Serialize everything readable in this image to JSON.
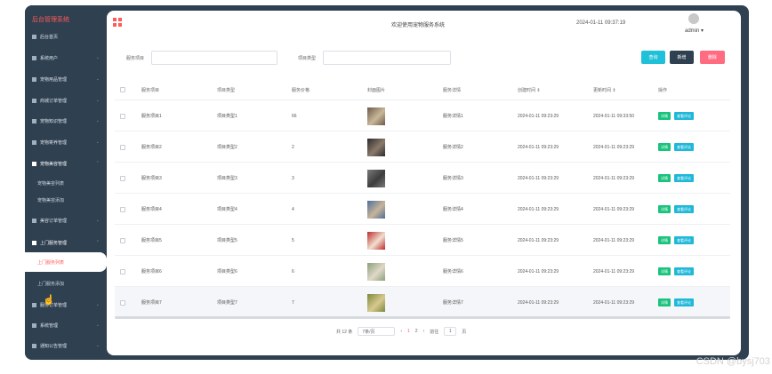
{
  "sidebar": {
    "brand": "后台管理系统",
    "items": [
      {
        "label": "后台首页",
        "arrow": ""
      },
      {
        "label": "系统用户",
        "arrow": "⌄"
      },
      {
        "label": "宠物用品管理",
        "arrow": "⌄"
      },
      {
        "label": "商城订单管理",
        "arrow": "⌄"
      },
      {
        "label": "宠物知识管理",
        "arrow": "⌄"
      },
      {
        "label": "宠物寄养管理",
        "arrow": "⌄"
      },
      {
        "label": "宠物美容管理",
        "arrow": "⌃"
      },
      {
        "label": "宠物美容列表",
        "arrow": ""
      },
      {
        "label": "宠物美容添加",
        "arrow": ""
      },
      {
        "label": "美容订单管理",
        "arrow": "⌄"
      },
      {
        "label": "上门服务管理",
        "arrow": "⌃"
      },
      {
        "label": "上门服务列表",
        "arrow": ""
      },
      {
        "label": "上门服务添加",
        "arrow": ""
      },
      {
        "label": "服务订单管理",
        "arrow": "⌄"
      },
      {
        "label": "系统管理",
        "arrow": "⌄"
      },
      {
        "label": "通知公告管理",
        "arrow": "⌄"
      }
    ]
  },
  "header": {
    "system_title": "欢迎使用宠物服务系统",
    "datetime": "2024-01-11 09:37:19",
    "user": "admin ▾"
  },
  "search": {
    "label1": "服务项目",
    "label2": "项目类型",
    "query_btn": "查询",
    "add_btn": "新增",
    "delete_btn": "删除"
  },
  "table": {
    "headers": [
      "服务项目",
      "项目类型",
      "服务价格",
      "封面图片",
      "服务详情",
      "创建时间 ⇕",
      "更新时间 ⇕",
      "操作"
    ],
    "rows": [
      {
        "name": "服务项目1",
        "type": "项目类型1",
        "price": "66",
        "detail": "服务详情1",
        "created": "2024-01-11 09:23:29",
        "updated": "2024-01-11 09:33:50"
      },
      {
        "name": "服务项目2",
        "type": "项目类型2",
        "price": "2",
        "detail": "服务详情2",
        "created": "2024-01-11 09:23:29",
        "updated": "2024-01-11 09:23:29"
      },
      {
        "name": "服务项目3",
        "type": "项目类型3",
        "price": "3",
        "detail": "服务详情3",
        "created": "2024-01-11 09:23:29",
        "updated": "2024-01-11 09:23:29"
      },
      {
        "name": "服务项目4",
        "type": "项目类型4",
        "price": "4",
        "detail": "服务详情4",
        "created": "2024-01-11 09:23:29",
        "updated": "2024-01-11 09:23:29"
      },
      {
        "name": "服务项目5",
        "type": "项目类型5",
        "price": "5",
        "detail": "服务详情5",
        "created": "2024-01-11 09:23:29",
        "updated": "2024-01-11 09:23:29"
      },
      {
        "name": "服务项目6",
        "type": "项目类型6",
        "price": "6",
        "detail": "服务详情6",
        "created": "2024-01-11 09:23:29",
        "updated": "2024-01-11 09:23:29"
      },
      {
        "name": "服务项目7",
        "type": "项目类型7",
        "price": "7",
        "detail": "服务详情7",
        "created": "2024-01-11 09:23:29",
        "updated": "2024-01-11 09:23:29"
      }
    ],
    "action_detail": "详情",
    "action_review": "查看评论"
  },
  "pager": {
    "total": "共 12 条",
    "page_size": "7条/页",
    "prev": "‹",
    "page1": "1",
    "page2": "2",
    "next": "›",
    "goto_label": "前往",
    "goto_value": "1",
    "page_unit": "页"
  },
  "watermark": "CSDN @bysj703",
  "colors": {
    "sidebar_bg": "#2f4050",
    "accent": "#ff5a5a",
    "query_btn": "#1fc0d8",
    "add_btn": "#2f4050",
    "delete_btn": "#ff6b81",
    "detail_btn": "#19c37d",
    "review_btn": "#1fb8d8"
  }
}
